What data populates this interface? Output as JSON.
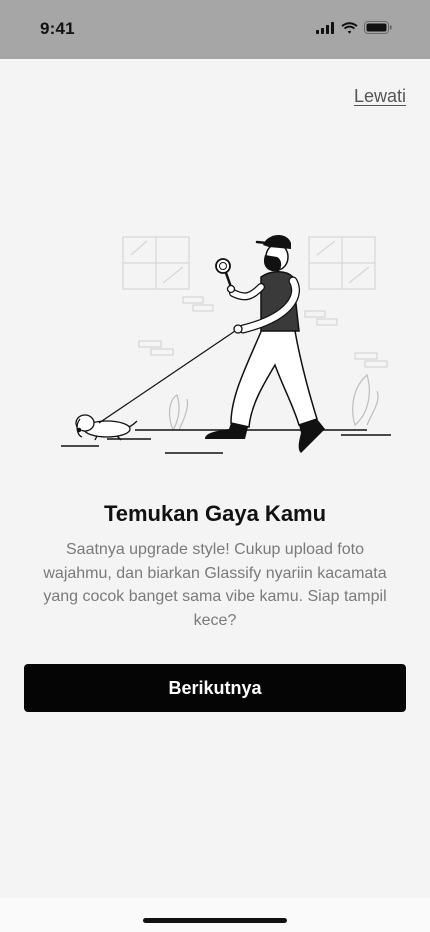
{
  "status_bar": {
    "time": "9:41",
    "icons": [
      "cellular-signal-icon",
      "wifi-icon",
      "battery-icon"
    ]
  },
  "header": {
    "skip_label": "Lewati"
  },
  "onboarding": {
    "illustration": "person-walking-dog-with-magnifier-illustration",
    "title": "Temukan Gaya Kamu",
    "description": "Saatnya upgrade style! Cukup upload foto wajahmu, dan biarkan Glassify nyariin kacamata yang cocok banget sama vibe kamu. Siap tampil kece?"
  },
  "actions": {
    "next_label": "Berikutnya"
  },
  "colors": {
    "status_bar_bg": "#a6a6a6",
    "background": "#f4f4f4",
    "button_bg": "#050505",
    "button_text": "#ffffff",
    "title_text": "#111111",
    "body_text": "#7a7a7a",
    "link_text": "#555555"
  }
}
